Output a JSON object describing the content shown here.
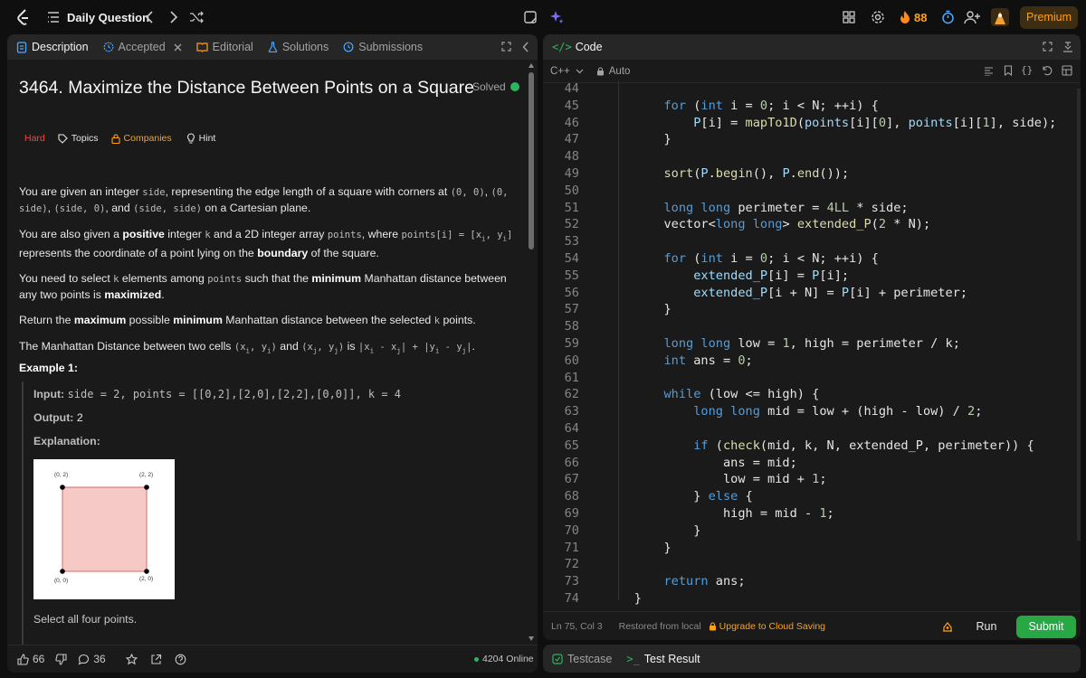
{
  "topbar": {
    "title": "Daily Question",
    "fire_count": "88",
    "premium_label": "Premium"
  },
  "left": {
    "tabs": [
      {
        "label": "Description"
      },
      {
        "label": "Accepted"
      },
      {
        "label": "Editorial"
      },
      {
        "label": "Solutions"
      },
      {
        "label": "Submissions"
      }
    ],
    "problem_title": "3464. Maximize the Distance Between Points on a Square",
    "solved_label": "Solved",
    "difficulty": "Hard",
    "topics": "Topics",
    "companies": "Companies",
    "hint": "Hint",
    "p1": [
      "You are given an integer ",
      "side",
      ", representing the edge length of a square with corners at ",
      "(0, 0)",
      ", ",
      "(0, side)",
      ", ",
      "(side, 0)",
      ", and ",
      "(side, side)",
      " on a Cartesian plane."
    ],
    "p2": [
      "You are also given a ",
      "positive",
      " integer ",
      "k",
      " and a 2D integer array ",
      "points",
      ", where ",
      "points[i] = [x",
      "i",
      ", y",
      "i",
      "]",
      " represents the coordinate of a point lying on the ",
      "boundary",
      " of the square."
    ],
    "p3": [
      "You need to select ",
      "k",
      " elements among ",
      "points",
      " such that the ",
      "minimum",
      " Manhattan distance between any two points is ",
      "maximized",
      "."
    ],
    "p4": [
      "Return the ",
      "maximum",
      " possible ",
      "minimum",
      " Manhattan distance between the selected ",
      "k",
      " points."
    ],
    "p5": [
      "The Manhattan Distance between two cells ",
      "(x",
      "i",
      ", y",
      "i",
      ")",
      " and ",
      "(x",
      "j",
      ", y",
      "j",
      ")",
      " is ",
      "|x",
      "i",
      " - x",
      "j",
      "| + |y",
      "i",
      " - y",
      "j",
      "|",
      "."
    ],
    "example_title": "Example 1:",
    "input_label": "Input:",
    "input_value": "side = 2, points = [[0,2],[2,0],[2,2],[0,0]], k = 4",
    "output_label": "Output:",
    "output_value": "2",
    "explanation_label": "Explanation:",
    "diagram_labels": {
      "tl": "(0, 2)",
      "tr": "(2, 2)",
      "bl": "(0, 0)",
      "br": "(2, 0)"
    },
    "explanation_text": "Select all four points.",
    "likes": "66",
    "comments": "36",
    "online": "4204 Online"
  },
  "code_panel": {
    "title": "Code",
    "language": "C++",
    "mode": "Auto",
    "status_pos": "Ln 75, Col 3",
    "status_restore": "Restored from local",
    "status_upgrade": "Upgrade to Cloud Saving",
    "run_label": "Run",
    "submit_label": "Submit"
  },
  "code_lines": [
    {
      "n": "44",
      "t": []
    },
    {
      "n": "45",
      "t": [
        [
          "i",
          "        "
        ],
        [
          "kw",
          "for"
        ],
        [
          "pl",
          " ("
        ],
        [
          "kw",
          "int"
        ],
        [
          "pl",
          " i = "
        ],
        [
          "num",
          "0"
        ],
        [
          "pl",
          "; i < N; ++i) {"
        ]
      ]
    },
    {
      "n": "46",
      "t": [
        [
          "i",
          "            "
        ],
        [
          "var",
          "P"
        ],
        [
          "pl",
          "[i] = "
        ],
        [
          "fn",
          "mapTo1D"
        ],
        [
          "pl",
          "("
        ],
        [
          "var",
          "points"
        ],
        [
          "pl",
          "[i]["
        ],
        [
          "num",
          "0"
        ],
        [
          "pl",
          "], "
        ],
        [
          "var",
          "points"
        ],
        [
          "pl",
          "[i]["
        ],
        [
          "num",
          "1"
        ],
        [
          "pl",
          "], side);"
        ]
      ]
    },
    {
      "n": "47",
      "t": [
        [
          "i",
          "        "
        ],
        [
          "pl",
          "}"
        ]
      ]
    },
    {
      "n": "48",
      "t": []
    },
    {
      "n": "49",
      "t": [
        [
          "i",
          "        "
        ],
        [
          "fn",
          "sort"
        ],
        [
          "pl",
          "("
        ],
        [
          "var",
          "P"
        ],
        [
          "pl",
          "."
        ],
        [
          "fn",
          "begin"
        ],
        [
          "pl",
          "(), "
        ],
        [
          "var",
          "P"
        ],
        [
          "pl",
          "."
        ],
        [
          "fn",
          "end"
        ],
        [
          "pl",
          "());"
        ]
      ]
    },
    {
      "n": "50",
      "t": []
    },
    {
      "n": "51",
      "t": [
        [
          "i",
          "        "
        ],
        [
          "kw",
          "long long"
        ],
        [
          "pl",
          " perimeter = "
        ],
        [
          "num",
          "4LL"
        ],
        [
          "pl",
          " * side;"
        ]
      ]
    },
    {
      "n": "52",
      "t": [
        [
          "i",
          "        "
        ],
        [
          "pl",
          "vector<"
        ],
        [
          "kw",
          "long long"
        ],
        [
          "pl",
          "> "
        ],
        [
          "fn",
          "extended_P"
        ],
        [
          "pl",
          "("
        ],
        [
          "num",
          "2"
        ],
        [
          "pl",
          " * N);"
        ]
      ]
    },
    {
      "n": "53",
      "t": []
    },
    {
      "n": "54",
      "t": [
        [
          "i",
          "        "
        ],
        [
          "kw",
          "for"
        ],
        [
          "pl",
          " ("
        ],
        [
          "kw",
          "int"
        ],
        [
          "pl",
          " i = "
        ],
        [
          "num",
          "0"
        ],
        [
          "pl",
          "; i < N; ++i) {"
        ]
      ]
    },
    {
      "n": "55",
      "t": [
        [
          "i",
          "            "
        ],
        [
          "var",
          "extended_P"
        ],
        [
          "pl",
          "[i] = "
        ],
        [
          "var",
          "P"
        ],
        [
          "pl",
          "[i];"
        ]
      ]
    },
    {
      "n": "56",
      "t": [
        [
          "i",
          "            "
        ],
        [
          "var",
          "extended_P"
        ],
        [
          "pl",
          "[i + N] = "
        ],
        [
          "var",
          "P"
        ],
        [
          "pl",
          "[i] + perimeter;"
        ]
      ]
    },
    {
      "n": "57",
      "t": [
        [
          "i",
          "        "
        ],
        [
          "pl",
          "}"
        ]
      ]
    },
    {
      "n": "58",
      "t": []
    },
    {
      "n": "59",
      "t": [
        [
          "i",
          "        "
        ],
        [
          "kw",
          "long long"
        ],
        [
          "pl",
          " low = "
        ],
        [
          "num",
          "1"
        ],
        [
          "pl",
          ", high = perimeter / k;"
        ]
      ]
    },
    {
      "n": "60",
      "t": [
        [
          "i",
          "        "
        ],
        [
          "kw",
          "int"
        ],
        [
          "pl",
          " ans = "
        ],
        [
          "num",
          "0"
        ],
        [
          "pl",
          ";"
        ]
      ]
    },
    {
      "n": "61",
      "t": []
    },
    {
      "n": "62",
      "t": [
        [
          "i",
          "        "
        ],
        [
          "kw",
          "while"
        ],
        [
          "pl",
          " (low <= high) {"
        ]
      ]
    },
    {
      "n": "63",
      "t": [
        [
          "i",
          "            "
        ],
        [
          "kw",
          "long long"
        ],
        [
          "pl",
          " mid = low + (high - low) / "
        ],
        [
          "num",
          "2"
        ],
        [
          "pl",
          ";"
        ]
      ]
    },
    {
      "n": "64",
      "t": []
    },
    {
      "n": "65",
      "t": [
        [
          "i",
          "            "
        ],
        [
          "kw",
          "if"
        ],
        [
          "pl",
          " ("
        ],
        [
          "fn",
          "check"
        ],
        [
          "pl",
          "(mid, k, N, extended_P, perimeter)) {"
        ]
      ]
    },
    {
      "n": "66",
      "t": [
        [
          "i",
          "                "
        ],
        [
          "pl",
          "ans = mid;"
        ]
      ]
    },
    {
      "n": "67",
      "t": [
        [
          "i",
          "                "
        ],
        [
          "pl",
          "low = mid + "
        ],
        [
          "num",
          "1"
        ],
        [
          "pl",
          ";"
        ]
      ]
    },
    {
      "n": "68",
      "t": [
        [
          "i",
          "            "
        ],
        [
          "pl",
          "} "
        ],
        [
          "kw",
          "else"
        ],
        [
          "pl",
          " {"
        ]
      ]
    },
    {
      "n": "69",
      "t": [
        [
          "i",
          "                "
        ],
        [
          "pl",
          "high = mid - "
        ],
        [
          "num",
          "1"
        ],
        [
          "pl",
          ";"
        ]
      ]
    },
    {
      "n": "70",
      "t": [
        [
          "i",
          "            "
        ],
        [
          "pl",
          "}"
        ]
      ]
    },
    {
      "n": "71",
      "t": [
        [
          "i",
          "        "
        ],
        [
          "pl",
          "}"
        ]
      ]
    },
    {
      "n": "72",
      "t": []
    },
    {
      "n": "73",
      "t": [
        [
          "i",
          "        "
        ],
        [
          "kw",
          "return"
        ],
        [
          "pl",
          " ans;"
        ]
      ]
    },
    {
      "n": "74",
      "t": [
        [
          "i",
          "    "
        ],
        [
          "pl",
          "}"
        ]
      ]
    }
  ],
  "bottom": {
    "testcase": "Testcase",
    "test_result": "Test Result"
  },
  "colors": {
    "accent_orange": "#ffa116",
    "hard_red": "#ef4743",
    "green": "#2db55d",
    "submit_green": "#28a745"
  }
}
